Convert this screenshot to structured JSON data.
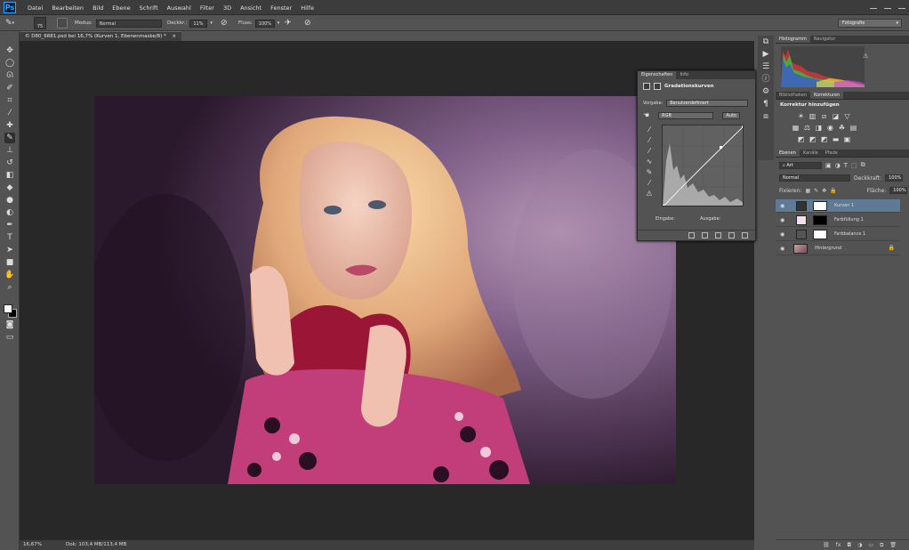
{
  "app": {
    "logo": "Ps"
  },
  "menu": [
    "Datei",
    "Bearbeiten",
    "Bild",
    "Ebene",
    "Schrift",
    "Auswahl",
    "Filter",
    "3D",
    "Ansicht",
    "Fenster",
    "Hilfe"
  ],
  "options": {
    "brush_size": "75",
    "mode_label": "Modus:",
    "mode_value": "Normal",
    "opacity_label": "Deckkr.:",
    "opacity_value": "11%",
    "flow_label": "Fluss:",
    "flow_value": "100%",
    "workspace": "Fotografie"
  },
  "document": {
    "tab_title": "© D80_6881.psd bei 16,7% (Kurven 1, Ebenenmaske/8) *",
    "zoom": "16,67%",
    "doc_info": "Dok: 103,4 MB/113,4 MB"
  },
  "properties": {
    "tabs": [
      "Eigenschaften",
      "Info"
    ],
    "title": "Gradationskurven",
    "preset_label": "Vorgabe:",
    "preset_value": "Benutzerdefiniert",
    "channel": "RGB",
    "auto_label": "Auto",
    "input_label": "Eingabe:",
    "output_label": "Ausgabe:"
  },
  "histogram": {
    "tabs": [
      "Histogramm",
      "Navigator"
    ]
  },
  "corrections": {
    "tabs": [
      "Bibliotheken",
      "Korrekturen"
    ],
    "title": "Korrektur hinzufügen"
  },
  "layers": {
    "tabs": [
      "Ebenen",
      "Kanäle",
      "Pfade"
    ],
    "filter": "Art",
    "blend_mode": "Normal",
    "opacity_label": "Deckkraft:",
    "opacity_value": "100%",
    "lock_label": "Fixieren:",
    "fill_label": "Fläche:",
    "fill_value": "100%",
    "items": [
      {
        "name": "Kurven 1"
      },
      {
        "name": "Farbfüllung 1"
      },
      {
        "name": "Farbbalance 1"
      },
      {
        "name": "Hintergrund"
      }
    ]
  }
}
